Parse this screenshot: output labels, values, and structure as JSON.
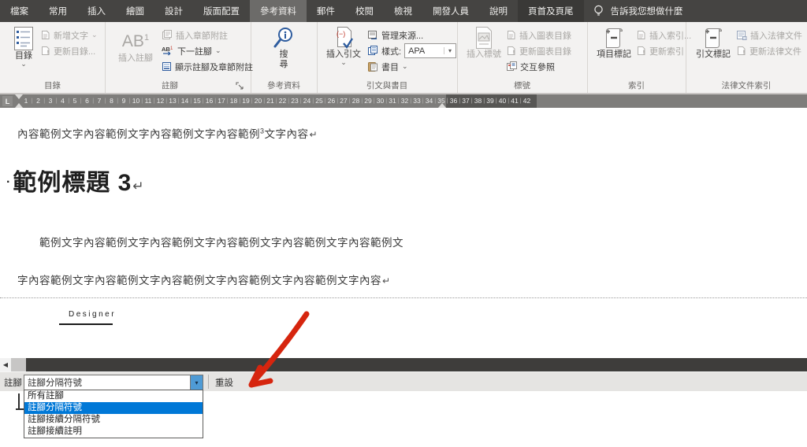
{
  "tabbar": {
    "tabs": [
      {
        "label": "檔案"
      },
      {
        "label": "常用"
      },
      {
        "label": "插入"
      },
      {
        "label": "繪圖"
      },
      {
        "label": "設計"
      },
      {
        "label": "版面配置"
      },
      {
        "label": "參考資料",
        "active": true
      },
      {
        "label": "郵件"
      },
      {
        "label": "校閱"
      },
      {
        "label": "檢視"
      },
      {
        "label": "開發人員"
      },
      {
        "label": "說明"
      },
      {
        "label": "頁首及頁尾",
        "contextual": true
      }
    ],
    "tellme": "告訴我您想做什麼"
  },
  "ribbon": {
    "groups": {
      "toc": {
        "label": "目錄",
        "big": "目錄",
        "small1": "新增文字",
        "small2": "更新目錄..."
      },
      "footnotes": {
        "label": "註腳",
        "big_glyph": "AB",
        "big_sup": "1",
        "big": "插入註腳",
        "small1": "插入章節附註",
        "small2": "下一註腳",
        "small3": "顯示註腳及章節附註"
      },
      "research": {
        "label": "參考資料",
        "big": "搜尋"
      },
      "citations": {
        "label": "引文與書目",
        "big": "插入引文",
        "small1": "管理來源...",
        "small2_label": "樣式:",
        "style_value": "APA",
        "small3": "書目"
      },
      "captions": {
        "label": "標號",
        "big": "插入標號",
        "small1": "插入圖表目錄",
        "small2": "更新圖表目錄",
        "small3": "交互參照"
      },
      "index": {
        "label": "索引",
        "big": "項目標記",
        "small1": "插入索引...",
        "small2": "更新索引"
      },
      "authorities": {
        "label": "法律文件索引",
        "big": "引文標記",
        "small1": "插入法律文件",
        "small2": "更新法律文件"
      }
    }
  },
  "glyphs": {
    "chevron_down": "⌄",
    "dropdown_arrow": "▾",
    "left_arrow": "◀",
    "return_mark": "↵"
  },
  "ruler": {
    "numbers": [
      1,
      2,
      3,
      4,
      5,
      6,
      7,
      8,
      9,
      10,
      11,
      12,
      13,
      14,
      15,
      16,
      17,
      18,
      19,
      20,
      21,
      22,
      23,
      24,
      25,
      26,
      27,
      28,
      29,
      30,
      31,
      32,
      33,
      34,
      35,
      36,
      37,
      38,
      39,
      40,
      41,
      42
    ],
    "tabstop": "L"
  },
  "document": {
    "line1_pre": "內容範例文字內容範例文字內容範例文字內容範例",
    "line1_sup": "3",
    "line1_post": "文字內容",
    "heading_bullet": "·",
    "heading": "範例標題 3",
    "para2": "範例文字內容範例文字內容範例文字內容範例文字內容範例文字內容範例文",
    "para3": "字內容範例文字內容範例文字內容範例文字內容範例文字內容範例文字內容",
    "footer_label": "Designer"
  },
  "footnote_pane": {
    "label": "註腳",
    "dropdown_value": "註腳分隔符號",
    "reset_label": "重設",
    "options": [
      "所有註腳",
      "註腳分隔符號",
      "註腳接續分隔符號",
      "註腳接續註明"
    ],
    "selected_option": "註腳分隔符號"
  },
  "colors": {
    "tabbar_bg": "#454442",
    "active_tab_bg": "#6c6b69",
    "ribbon_bg": "#f3f2f1",
    "accent_blue": "#2e5c9e",
    "accent_red": "#c0392b",
    "selection_blue": "#0078d7",
    "annotation_red": "#d6250e"
  }
}
